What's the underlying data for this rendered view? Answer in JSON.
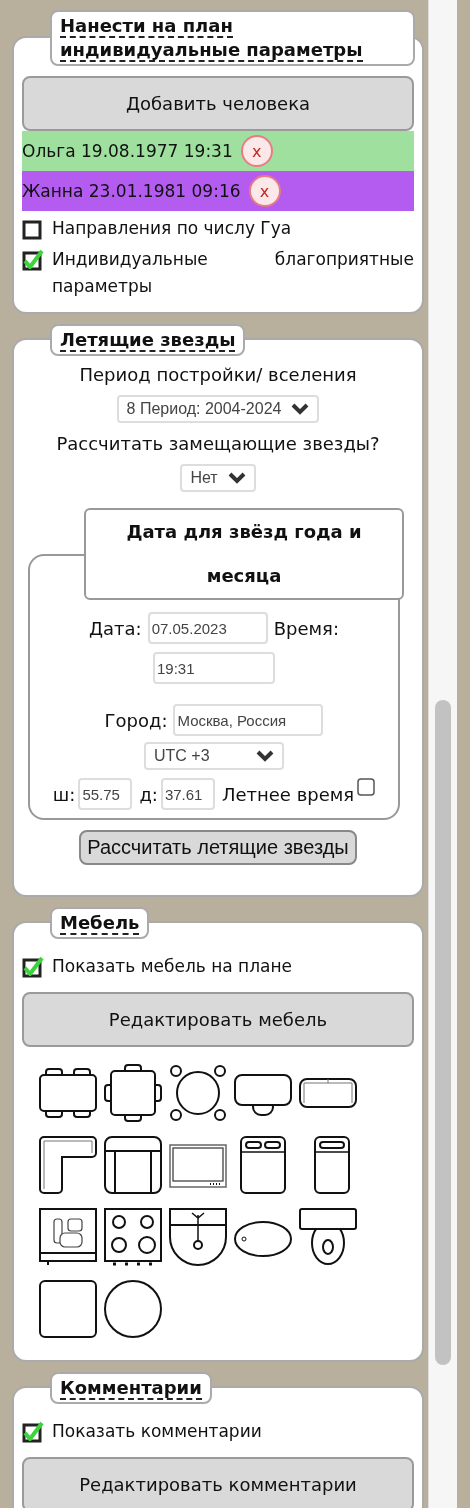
{
  "sections": [
    {
      "kind": "people",
      "title": "Нанести на план индивидуальные параметры",
      "button": "Добавить человека",
      "people": [
        {
          "label": "Ольга 19.08.1977 19:31",
          "color": "#9fe09f",
          "remove": "x"
        },
        {
          "label": "Жанна 23.01.1981 09:16",
          "color": "#b45cf0",
          "remove": "x"
        }
      ],
      "options": [
        {
          "label": "Направления по числу Гуа",
          "checked": false
        },
        {
          "label": "Индивидуальные благоприятные параметры",
          "checked": true
        }
      ]
    },
    {
      "kind": "stars",
      "title": "Летящие звезды",
      "period_label": "Период постройки/ вселения",
      "period_select": "8 Период: 2004-2024",
      "replace_label": "Рассчитать замещающие звезды?",
      "replace_select": "Нет",
      "date_group": {
        "title": "Дата для звёзд года и месяца",
        "date_label": "Дата:",
        "date": "07.05.2023",
        "time_label": "Время:",
        "time": "19:31",
        "city_label": "Город:",
        "city": "Москва, Россия",
        "timezone": "UTC +3",
        "lat_label": "ш:",
        "lat": "55.75",
        "lon_label": "д:",
        "lon": "37.61",
        "dst_label": "Летнее время",
        "dst_checked": false
      },
      "button": "Рассчитать летящие звезды"
    },
    {
      "kind": "furniture",
      "title": "Мебель",
      "show": {
        "label": "Показать мебель на плане",
        "checked": true
      },
      "button": "Редактировать мебель",
      "items": [
        {
          "kind": "rect-table"
        },
        {
          "kind": "square-table"
        },
        {
          "kind": "round-table"
        },
        {
          "kind": "desk"
        },
        {
          "kind": "sofa"
        },
        {
          "kind": "corner-sofa"
        },
        {
          "kind": "armchair"
        },
        {
          "kind": "tv"
        },
        {
          "kind": "double-bed"
        },
        {
          "kind": "single-bed"
        },
        {
          "kind": "kitchen"
        },
        {
          "kind": "stove"
        },
        {
          "kind": "sink"
        },
        {
          "kind": "bathtub"
        },
        {
          "kind": "toilet"
        },
        {
          "kind": "square"
        },
        {
          "kind": "circle"
        }
      ]
    },
    {
      "kind": "comments",
      "title": "Комментарии",
      "show": {
        "label": "Показать комментарии",
        "checked": true
      },
      "button": "Редактировать комментарии"
    }
  ]
}
